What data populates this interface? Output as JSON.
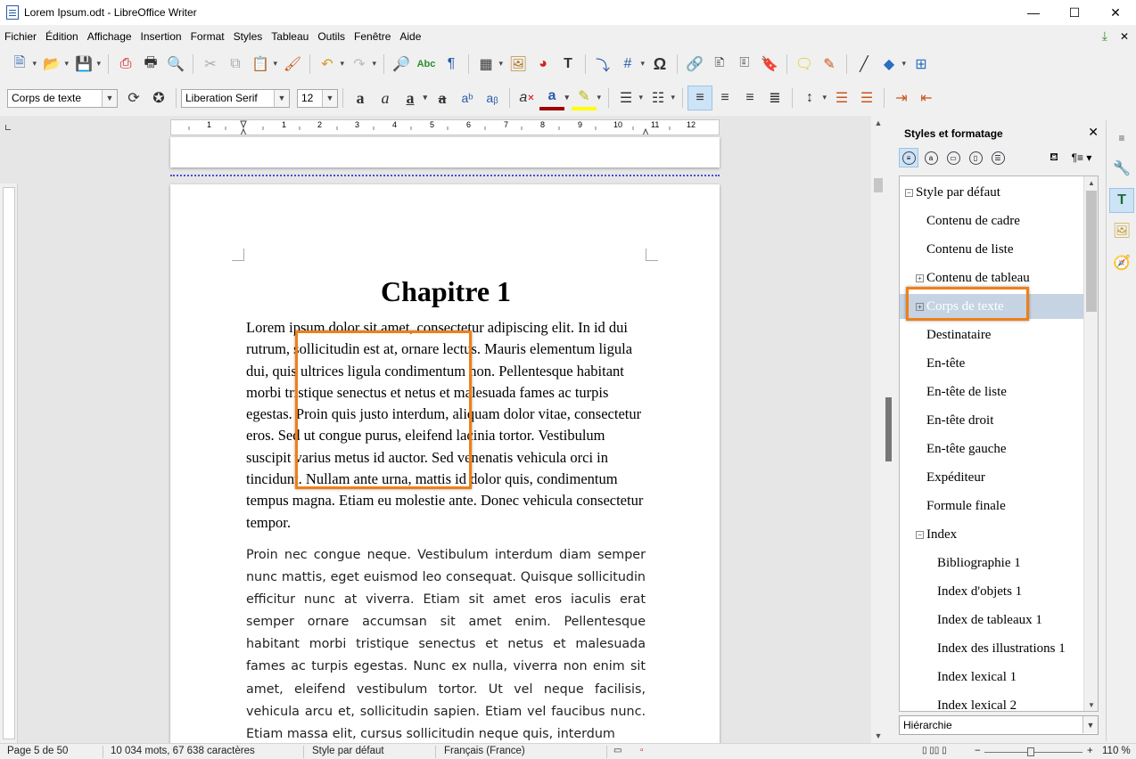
{
  "window": {
    "title": "Lorem Ipsum.odt - LibreOffice Writer",
    "minimize": "—",
    "maximize": "☐",
    "close": "✕"
  },
  "menu": [
    "Fichier",
    "Édition",
    "Affichage",
    "Insertion",
    "Format",
    "Styles",
    "Tableau",
    "Outils",
    "Fenêtre",
    "Aide"
  ],
  "formatting": {
    "paragraph_style": "Corps de texte",
    "font_name": "Liberation Serif",
    "font_size": "12"
  },
  "document": {
    "chapter_title": "Chapitre 1",
    "paragraph1": "Lorem ipsum dolor sit amet, consectetur adipiscing elit. In id dui rutrum, sollicitudin est at, ornare lectus. Mauris elementum ligula dui, quis ultrices ligula condimentum non. Pellentesque habitant morbi tristique senectus et netus et malesuada fames ac turpis egestas. Proin quis justo interdum, aliquam dolor vitae, consectetur eros. Sed ut congue purus, eleifend lacinia tortor. Vestibulum suscipit varius metus id auctor. Sed venenatis vehicula orci in tincidunt. Nullam ante urna, mattis id dolor quis, condimentum tempus magna. Etiam eu molestie ante. Donec vehicula consectetur tempor.",
    "paragraph2": "Proin nec congue neque. Vestibulum interdum diam semper nunc mattis, eget euismod leo consequat. Quisque sollicitudin efficitur nunc at viverra. Etiam sit amet eros iaculis erat semper ornare accumsan sit amet enim. Pellentesque habitant morbi tristique senectus et netus et malesuada fames ac turpis egestas. Nunc ex nulla, viverra non enim sit amet, eleifend vestibulum tortor. Ut vel neque facilisis, vehicula arcu et, sollicitudin sapien. Etiam vel faucibus nunc. Etiam massa elit, cursus sollicitudin neque quis, interdum"
  },
  "ruler_numbers": [
    "1",
    "1",
    "2",
    "3",
    "4",
    "5",
    "6",
    "7",
    "8",
    "9",
    "10",
    "11",
    "12"
  ],
  "sidebar": {
    "title": "Styles et formatage",
    "close": "✕",
    "filter": "Hiérarchie",
    "styles": [
      {
        "label": "Style par défaut",
        "expander": "−"
      },
      {
        "label": "Contenu de cadre",
        "expander": ""
      },
      {
        "label": "Contenu de liste",
        "expander": ""
      },
      {
        "label": "Contenu de tableau",
        "expander": "+"
      },
      {
        "label": "Corps de texte",
        "expander": "+",
        "selected": true
      },
      {
        "label": "Destinataire",
        "expander": ""
      },
      {
        "label": "En-tête",
        "expander": ""
      },
      {
        "label": "En-tête de liste",
        "expander": ""
      },
      {
        "label": "En-tête droit",
        "expander": ""
      },
      {
        "label": "En-tête gauche",
        "expander": ""
      },
      {
        "label": "Expéditeur",
        "expander": ""
      },
      {
        "label": "Formule finale",
        "expander": ""
      },
      {
        "label": "Index",
        "expander": "−"
      },
      {
        "label": "Bibliographie 1",
        "expander": ""
      },
      {
        "label": "Index d'objets 1",
        "expander": ""
      },
      {
        "label": "Index de tableaux 1",
        "expander": ""
      },
      {
        "label": "Index des illustrations 1",
        "expander": ""
      },
      {
        "label": "Index lexical 1",
        "expander": ""
      },
      {
        "label": "Index lexical 2",
        "expander": ""
      }
    ]
  },
  "statusbar": {
    "page": "Page 5 de 50",
    "words": "10 034 mots, 67 638 caractères",
    "page_style": "Style par défaut",
    "language": "Français (France)",
    "zoom": "110 %"
  },
  "colors": {
    "highlight": "#f07f16",
    "selection": "#c5d3e2",
    "pagebreak": "#4b4bd6"
  }
}
